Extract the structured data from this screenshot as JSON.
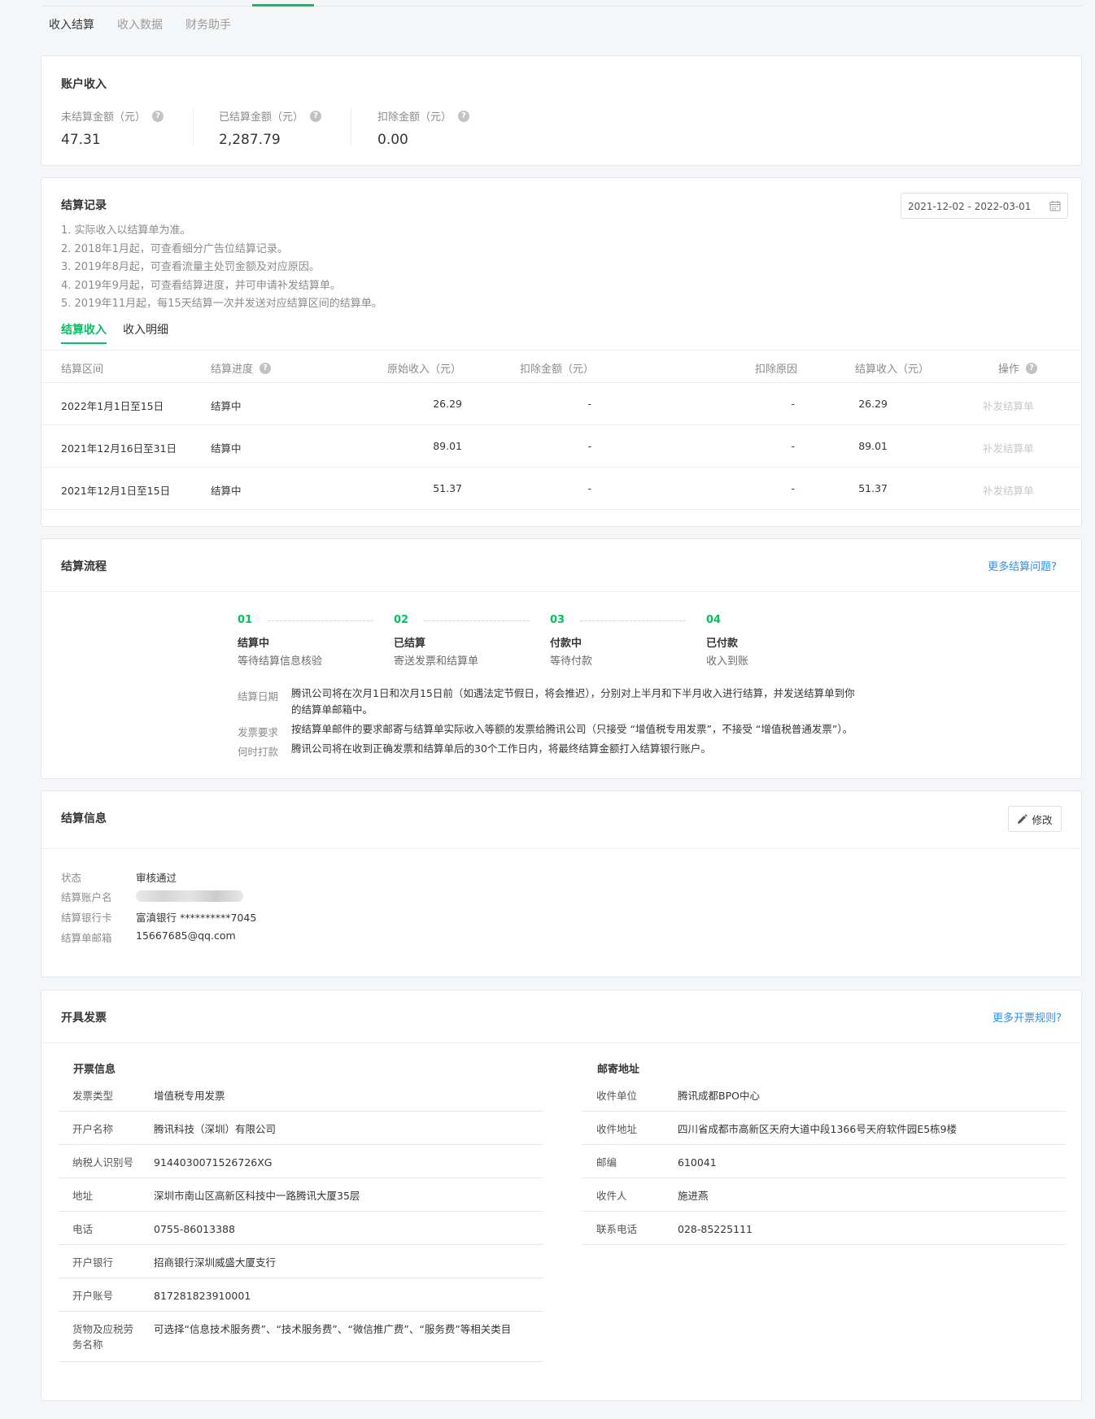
{
  "nav": {
    "tabs": [
      "收入结算",
      "收入数据",
      "财务助手"
    ]
  },
  "account": {
    "title": "账户收入",
    "stats": [
      {
        "label": "未结算金额（元）",
        "value": "47.31"
      },
      {
        "label": "已结算金额（元）",
        "value": "2,287.79"
      },
      {
        "label": "扣除金额（元）",
        "value": "0.00"
      }
    ]
  },
  "records": {
    "title": "结算记录",
    "date_range": "2021-12-02 - 2022-03-01",
    "notes": [
      "1. 实际收入以结算单为准。",
      "2. 2018年1月起，可查看细分广告位结算记录。",
      "3. 2019年8月起，可查看流量主处罚金额及对应原因。",
      "4. 2019年9月起，可查看结算进度，并可申请补发结算单。",
      "5. 2019年11月起，每15天结算一次并发送对应结算区间的结算单。"
    ],
    "tabs": [
      "结算收入",
      "收入明细"
    ],
    "columns": [
      "结算区间",
      "结算进度",
      "原始收入（元）",
      "扣除金额（元）",
      "扣除原因",
      "结算收入（元）",
      "操作"
    ],
    "rows": [
      {
        "period": "2022年1月1日至15日",
        "status": "结算中",
        "original": "26.29",
        "deducted": "-",
        "reason": "-",
        "settled": "26.29",
        "action": "补发结算单"
      },
      {
        "period": "2021年12月16日至31日",
        "status": "结算中",
        "original": "89.01",
        "deducted": "-",
        "reason": "-",
        "settled": "89.01",
        "action": "补发结算单"
      },
      {
        "period": "2021年12月1日至15日",
        "status": "结算中",
        "original": "51.37",
        "deducted": "-",
        "reason": "-",
        "settled": "51.37",
        "action": "补发结算单"
      }
    ]
  },
  "flow": {
    "title": "结算流程",
    "more_link": "更多结算问题?",
    "steps": [
      {
        "num": "01",
        "title": "结算中",
        "desc": "等待结算信息核验"
      },
      {
        "num": "02",
        "title": "已结算",
        "desc": "寄送发票和结算单"
      },
      {
        "num": "03",
        "title": "付款中",
        "desc": "等待付款"
      },
      {
        "num": "04",
        "title": "已付款",
        "desc": "收入到账"
      }
    ],
    "details": [
      {
        "key": "结算日期",
        "value_line1": "腾讯公司将在次月1日和次月15日前（如遇法定节假日，将会推迟），分别对上半月和下半月收入进行结算，并发送结算单到你",
        "value_line2": "的结算单邮箱中。"
      },
      {
        "key": "发票要求",
        "value_line1": "按结算单邮件的要求邮寄与结算单实际收入等额的发票给腾讯公司（只接受 “增值税专用发票”，不接受 “增值税普通发票”）。"
      },
      {
        "key": "何时打款",
        "value_line1": "腾讯公司将在收到正确发票和结算单后的30个工作日内，将最终结算金额打入结算银行账户。"
      }
    ]
  },
  "settle_info": {
    "title": "结算信息",
    "edit_label": "修改",
    "status_label": "状态",
    "status_value": "审核通过",
    "account_label": "结算账户名",
    "bank_label": "结算银行卡",
    "bank_value": "富滇银行 **********7045",
    "email_label": "结算单邮箱",
    "email_value": "15667685@qq.com"
  },
  "invoice": {
    "title": "开具发票",
    "more_link": "更多开票规则?",
    "info_title": "开票信息",
    "info_rows": [
      {
        "key": "发票类型",
        "value": "增值税专用发票"
      },
      {
        "key": "开户名称",
        "value": "腾讯科技（深圳）有限公司"
      },
      {
        "key": "纳税人识别号",
        "value": "9144030071526726XG"
      },
      {
        "key": "地址",
        "value": "深圳市南山区高新区科技中一路腾讯大厦35层"
      },
      {
        "key": "电话",
        "value": "0755-86013388"
      },
      {
        "key": "开户银行",
        "value": "招商银行深圳威盛大厦支行"
      },
      {
        "key": "开户账号",
        "value": "817281823910001"
      },
      {
        "key": "货物及应税劳务名称",
        "value": "可选择“信息技术服务费”、“技术服务费”、“微信推广费”、“服务费”等相关类目"
      }
    ],
    "mail_title": "邮寄地址",
    "mail_rows": [
      {
        "key": "收件单位",
        "value": "腾讯成都BPO中心"
      },
      {
        "key": "收件地址",
        "value": "四川省成都市高新区天府大道中段1366号天府软件园E5栋9楼"
      },
      {
        "key": "邮编",
        "value": "610041"
      },
      {
        "key": "收件人",
        "value": "施进燕"
      },
      {
        "key": "联系电话",
        "value": "028-85225111"
      }
    ]
  }
}
